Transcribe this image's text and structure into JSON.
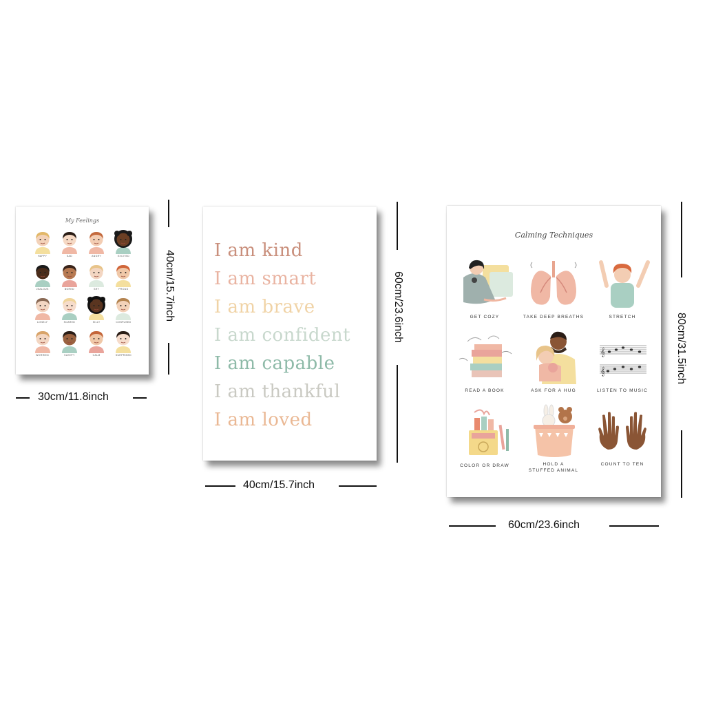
{
  "poster_feelings": {
    "title": "My Feelings",
    "labels": [
      "HAPPY",
      "SAD",
      "ANGRY",
      "EXCITED",
      "JEALOUS",
      "BORED",
      "SHY",
      "PROUD",
      "LONELY",
      "SCARED",
      "SILLY",
      "CONFUSED",
      "WORRIED",
      "SLEEPY",
      "CALM",
      "SURPRISED"
    ],
    "width_label": "30cm/11.8inch",
    "height_label": "40cm/15.7inch"
  },
  "poster_affirmations": {
    "lines": [
      "I am kind",
      "I am smart",
      "I am brave",
      "I am confident",
      "I am capable",
      "I am thankful",
      "I am loved"
    ],
    "colors": [
      "#c98f7c",
      "#e9b3a1",
      "#f0d3a6",
      "#c8d8cd",
      "#8ebaa8",
      "#c9c9c2",
      "#eab894"
    ],
    "width_label": "40cm/15.7inch",
    "height_label": "60cm/23.6inch"
  },
  "poster_calming": {
    "title": "Calming Techniques",
    "items": [
      {
        "label": "GET COZY",
        "icon": "cozy-girl-icon"
      },
      {
        "label": "TAKE DEEP BREATHS",
        "icon": "lungs-icon"
      },
      {
        "label": "STRETCH",
        "icon": "stretch-boy-icon"
      },
      {
        "label": "READ A BOOK",
        "icon": "books-icon"
      },
      {
        "label": "ASK FOR A HUG",
        "icon": "hug-icon"
      },
      {
        "label": "LISTEN TO MUSIC",
        "icon": "music-notes-icon"
      },
      {
        "label": "COLOR OR DRAW",
        "icon": "crayons-icon"
      },
      {
        "label": "HOLD A STUFFED ANIMAL",
        "label_line1": "HOLD A",
        "label_line2": "STUFFED ANIMAL",
        "icon": "stuffed-animal-icon"
      },
      {
        "label": "COUNT TO TEN",
        "icon": "hands-icon"
      }
    ],
    "width_label": "60cm/23.6inch",
    "height_label": "80cm/31.5inch"
  }
}
